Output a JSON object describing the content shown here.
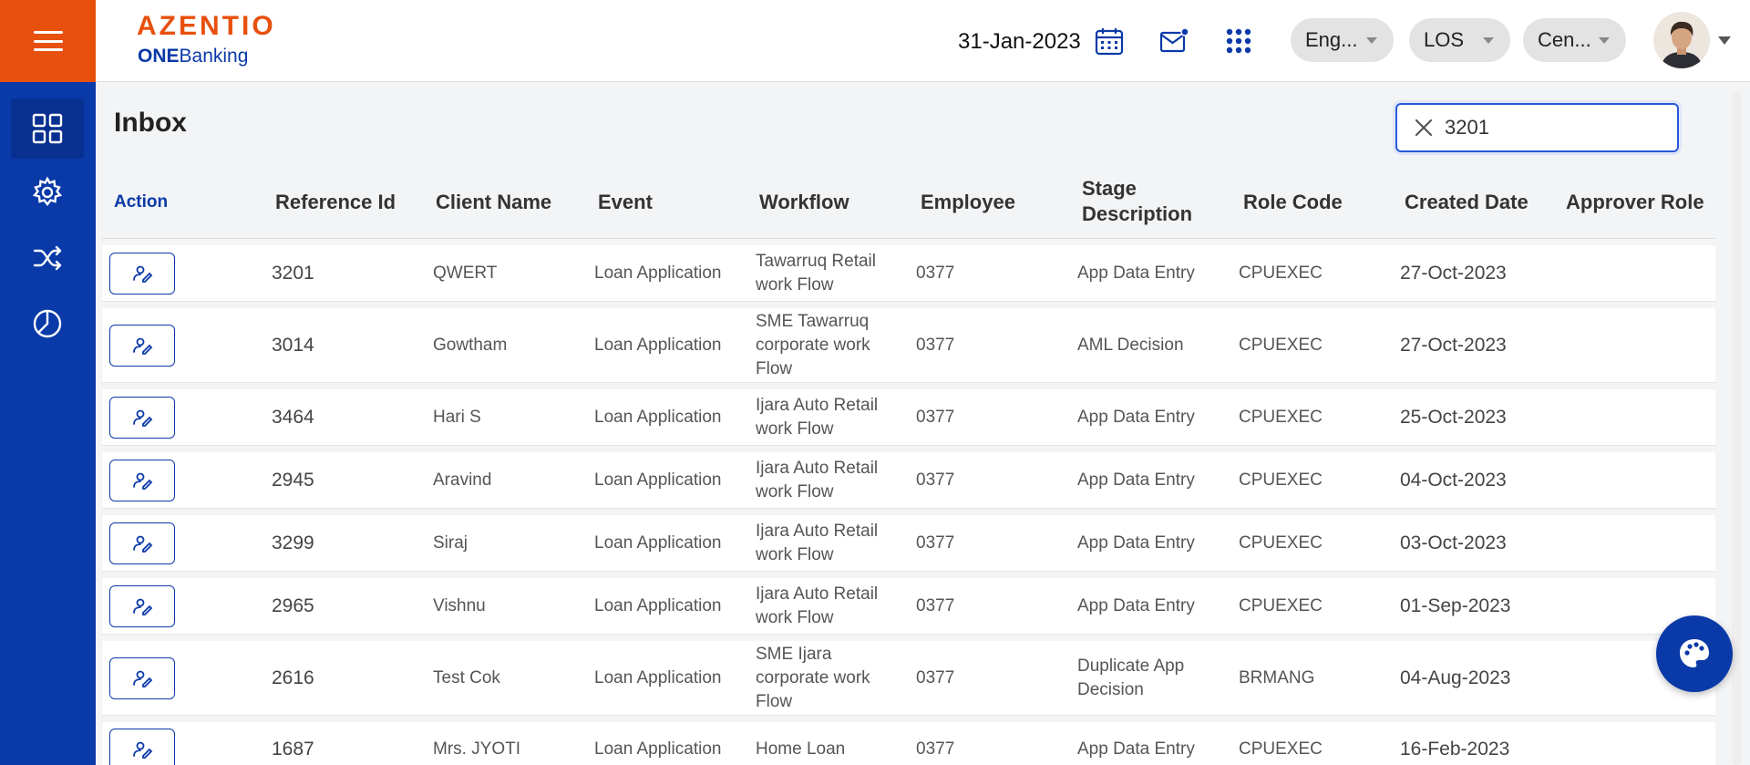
{
  "brand": {
    "name": "AZENTIO",
    "sub_bold": "ONE",
    "sub_regular": "Banking"
  },
  "header": {
    "date": "31-Jan-2023",
    "language": "Eng...",
    "module": "LOS",
    "branch": "Cen..."
  },
  "icons": {
    "menu": "hamburger-icon",
    "dashboard": "dashboard-grid-icon",
    "settings": "gear-icon",
    "workflow": "shuffle-icon",
    "reports": "pie-chart-icon",
    "calendar": "calendar-icon",
    "mail": "mail-notification-icon",
    "apps": "apps-grid-icon",
    "clear": "close-icon",
    "action": "user-edit-icon",
    "theme": "palette-icon"
  },
  "colors": {
    "brand_orange": "#e8500e",
    "brand_blue": "#0a39a8"
  },
  "page": {
    "title": "Inbox"
  },
  "search": {
    "value": "3201"
  },
  "table": {
    "columns": [
      "Action",
      "Reference Id",
      "Client Name",
      "Event",
      "Workflow",
      "Employee",
      "Stage Description",
      "Role Code",
      "Created Date",
      "Approver Role"
    ],
    "rows": [
      {
        "ref": "3201",
        "client": "QWERT",
        "event": "Loan Application",
        "workflow": "Tawarruq Retail work Flow",
        "employee": "0377",
        "stage": "App Data Entry",
        "role": "CPUEXEC",
        "created": "27-Oct-2023",
        "approver": ""
      },
      {
        "ref": "3014",
        "client": "Gowtham",
        "event": "Loan Application",
        "workflow": "SME Tawarruq corporate work Flow",
        "employee": "0377",
        "stage": "AML Decision",
        "role": "CPUEXEC",
        "created": "27-Oct-2023",
        "approver": ""
      },
      {
        "ref": "3464",
        "client": "Hari S",
        "event": "Loan Application",
        "workflow": "Ijara Auto Retail work Flow",
        "employee": "0377",
        "stage": "App Data Entry",
        "role": "CPUEXEC",
        "created": "25-Oct-2023",
        "approver": ""
      },
      {
        "ref": "2945",
        "client": "Aravind",
        "event": "Loan Application",
        "workflow": "Ijara Auto Retail work Flow",
        "employee": "0377",
        "stage": "App Data Entry",
        "role": "CPUEXEC",
        "created": "04-Oct-2023",
        "approver": ""
      },
      {
        "ref": "3299",
        "client": "Siraj",
        "event": "Loan Application",
        "workflow": "Ijara Auto Retail work Flow",
        "employee": "0377",
        "stage": "App Data Entry",
        "role": "CPUEXEC",
        "created": "03-Oct-2023",
        "approver": ""
      },
      {
        "ref": "2965",
        "client": "Vishnu",
        "event": "Loan Application",
        "workflow": "Ijara Auto Retail work Flow",
        "employee": "0377",
        "stage": "App Data Entry",
        "role": "CPUEXEC",
        "created": "01-Sep-2023",
        "approver": ""
      },
      {
        "ref": "2616",
        "client": "Test Cok",
        "event": "Loan Application",
        "workflow": "SME Ijara corporate work Flow",
        "employee": "0377",
        "stage": "Duplicate App Decision",
        "role": "BRMANG",
        "created": "04-Aug-2023",
        "approver": ""
      },
      {
        "ref": "1687",
        "client": "Mrs. JYOTI",
        "event": "Loan Application",
        "workflow": "Home Loan",
        "employee": "0377",
        "stage": "App Data Entry",
        "role": "CPUEXEC",
        "created": "16-Feb-2023",
        "approver": ""
      }
    ]
  }
}
